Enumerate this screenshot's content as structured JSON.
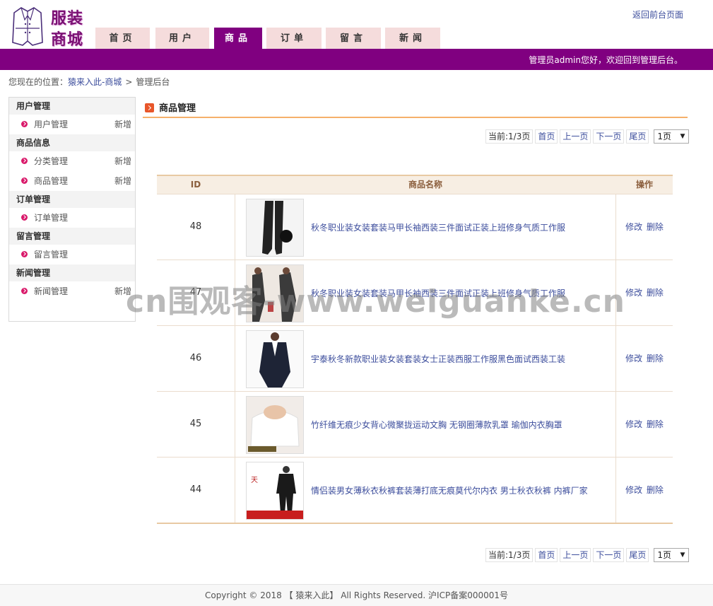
{
  "logo": {
    "line1": "服装",
    "line2": "商城"
  },
  "nav": {
    "tabs": [
      {
        "label": "首页",
        "active": false
      },
      {
        "label": "用户",
        "active": false
      },
      {
        "label": "商品",
        "active": true
      },
      {
        "label": "订单",
        "active": false
      },
      {
        "label": "留言",
        "active": false
      },
      {
        "label": "新闻",
        "active": false
      }
    ]
  },
  "header": {
    "back_link": "返回前台页面",
    "welcome": "管理员admin您好，欢迎回到管理后台。"
  },
  "breadcrumb": {
    "prefix": "您现在的位置：",
    "site": "猿来入此-商城",
    "sep": ">",
    "current": "管理后台"
  },
  "sidebar": {
    "groups": [
      {
        "title": "用户管理",
        "items": [
          {
            "label": "用户管理",
            "add": "新增"
          }
        ]
      },
      {
        "title": "商品信息",
        "items": [
          {
            "label": "分类管理",
            "add": "新增"
          },
          {
            "label": "商品管理",
            "add": "新增"
          }
        ]
      },
      {
        "title": "订单管理",
        "items": [
          {
            "label": "订单管理",
            "add": ""
          }
        ]
      },
      {
        "title": "留言管理",
        "items": [
          {
            "label": "留言管理",
            "add": ""
          }
        ]
      },
      {
        "title": "新闻管理",
        "items": [
          {
            "label": "新闻管理",
            "add": "新增"
          }
        ]
      }
    ]
  },
  "main": {
    "title": "商品管理"
  },
  "pager": {
    "info": "当前:1/3页",
    "first": "首页",
    "prev": "上一页",
    "next": "下一页",
    "last": "尾页",
    "select": "1页"
  },
  "table": {
    "headers": {
      "id": "ID",
      "name": "商品名称",
      "op": "操作"
    },
    "rows": [
      {
        "id": "48",
        "name": "秋冬职业装女装套装马甲长袖西装三件面试正装上班修身气质工作服",
        "edit": "修改",
        "del": "删除"
      },
      {
        "id": "47",
        "name": "秋冬职业装女装套装马甲长袖西装三件面试正装上班修身气质工作服",
        "edit": "修改",
        "del": "删除"
      },
      {
        "id": "46",
        "name": "宇泰秋冬新款职业装女装套装女士正装西服工作服黑色面试西装工装",
        "edit": "修改",
        "del": "删除"
      },
      {
        "id": "45",
        "name": "竹纤维无痕少女背心微聚拢运动文胸 无钢圈薄款乳罩 瑜伽内衣胸罩",
        "edit": "修改",
        "del": "删除"
      },
      {
        "id": "44",
        "name": "情侣装男女薄秋衣秋裤套装薄打底无痕莫代尔内衣 男士秋衣秋裤 内裤厂家",
        "edit": "修改",
        "del": "删除"
      }
    ]
  },
  "watermark": "cn围观客-www.weiguanke.cn",
  "footer": "Copyright © 2018 【 猿来入此】 All Rights Reserved. 沪ICP备案000001号"
}
